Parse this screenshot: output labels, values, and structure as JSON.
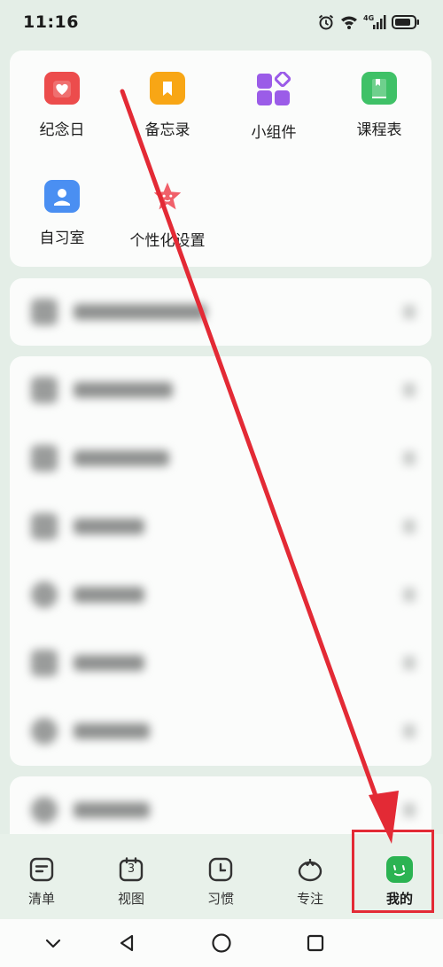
{
  "status": {
    "time": "11:16",
    "network": "4G"
  },
  "tools": [
    {
      "label": "纪念日",
      "icon": "calendar-heart-icon",
      "color": "#ec4c4c"
    },
    {
      "label": "备忘录",
      "icon": "bookmark-icon",
      "color": "#f8a615"
    },
    {
      "label": "小组件",
      "icon": "widgets-icon",
      "color": "#9b5ce8"
    },
    {
      "label": "课程表",
      "icon": "book-icon",
      "color": "#3fc167"
    },
    {
      "label": "自习室",
      "icon": "study-room-icon",
      "color": "#4a8ff2"
    },
    {
      "label": "个性化设置",
      "icon": "star-face-icon",
      "color": "#f0606a"
    }
  ],
  "tabs": [
    {
      "label": "清单",
      "icon": "list-icon",
      "active": false
    },
    {
      "label": "视图",
      "icon": "calendar-icon",
      "badge": "3",
      "active": false
    },
    {
      "label": "习惯",
      "icon": "clock-icon",
      "active": false
    },
    {
      "label": "专注",
      "icon": "tomato-icon",
      "active": false
    },
    {
      "label": "我的",
      "icon": "profile-face-icon",
      "active": true
    }
  ],
  "colors": {
    "accent": "#2bb352",
    "annotation": "#e32a35",
    "background": "#e4eee7"
  }
}
